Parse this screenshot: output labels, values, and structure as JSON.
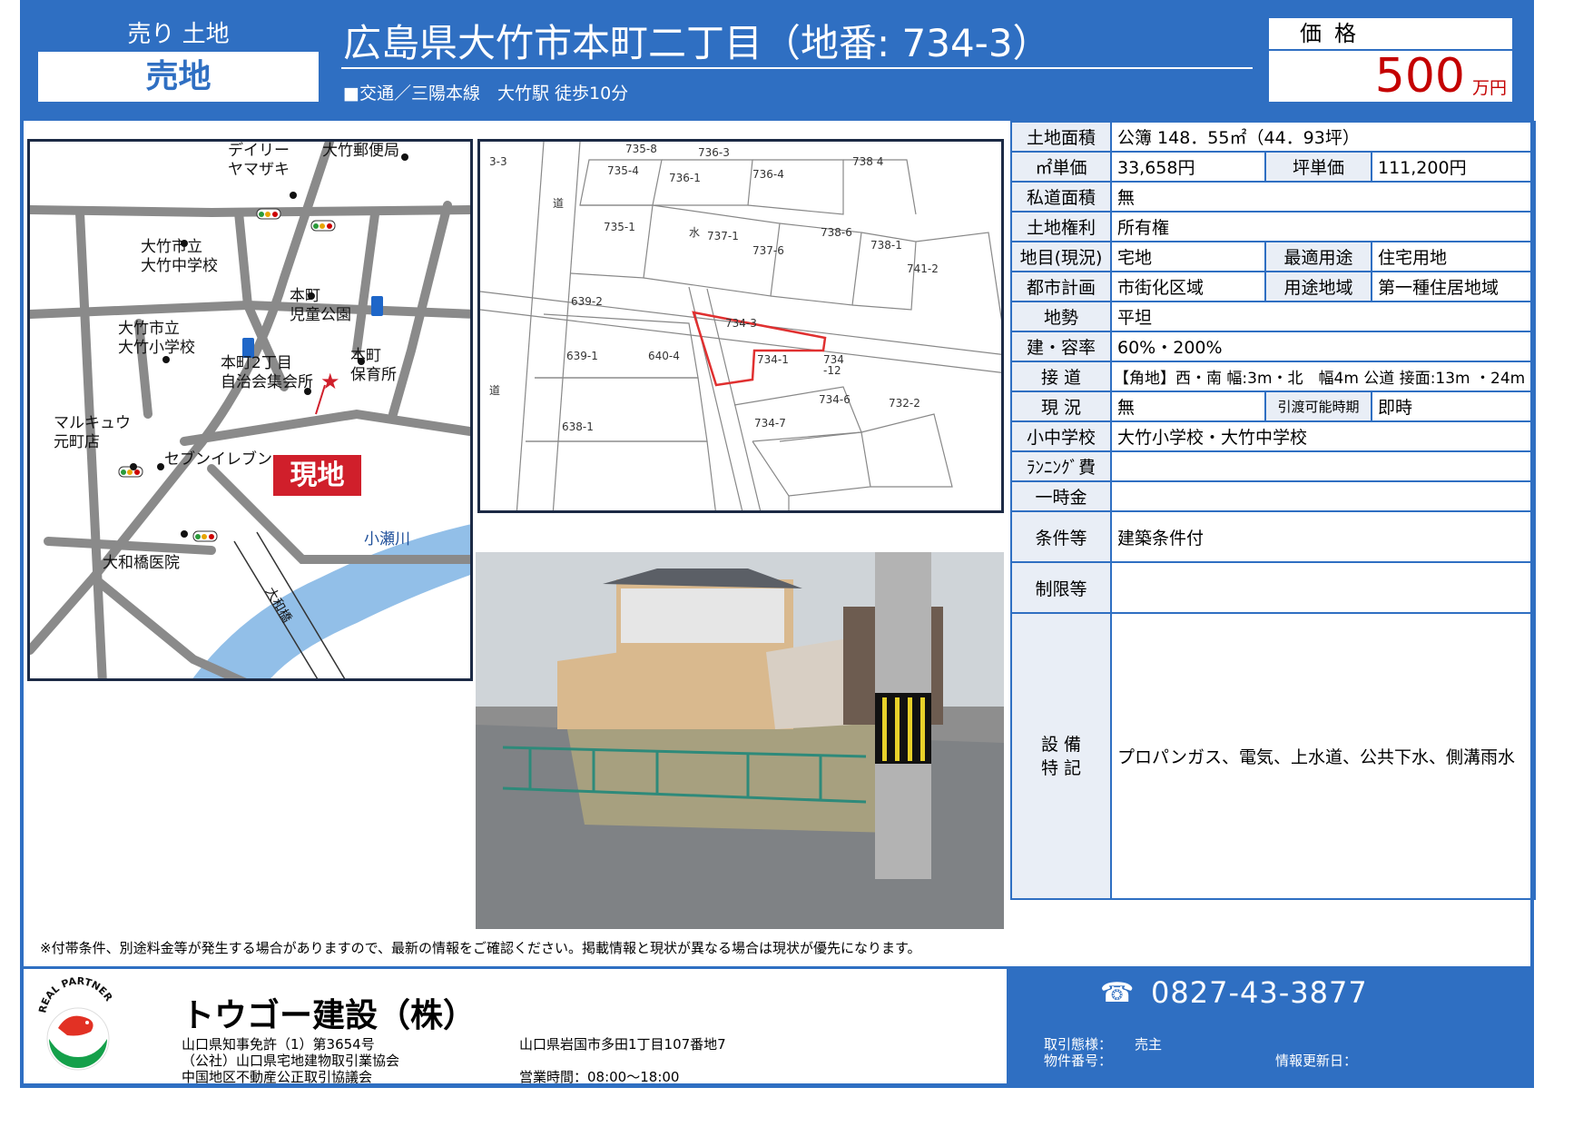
{
  "header": {
    "category_top": "売り 土地",
    "category_bottom": "売地",
    "title": "広島県大竹市本町二丁目（地番: 734-3）",
    "station": "■交通／三陽本線　大竹駅 徒歩10分",
    "price_label": "価格",
    "price_value": "500",
    "price_unit": "万円"
  },
  "map": {
    "labels": {
      "daily": "デイリー\nヤマザキ",
      "post": "大竹郵便局",
      "jhs": "大竹市立\n大竹中学校",
      "park": "本町\n児童公園",
      "es": "大竹市立\n大竹小学校",
      "hall": "本町2丁目\n自治会集会所",
      "nursery": "本町\n保育所",
      "genchi": "現地",
      "marukyu": "マルキュウ\n元町店",
      "seven": "セブンイレブン",
      "river": "小瀬川",
      "hospital": "大和橋医院",
      "bridge": "大和橋"
    }
  },
  "plot": {
    "lots": [
      "735-8",
      "736-3",
      "738 4",
      "3-3",
      "735-4",
      "736-1",
      "736-4",
      "道",
      "735-1",
      "水",
      "737-1",
      "737-6",
      "738-6",
      "738-1",
      "741-2",
      "639-2",
      "734-3",
      "639-1",
      "640-4",
      "734-1",
      "734\n-12",
      "道",
      "734-6",
      "732-2",
      "638-1",
      "734-7"
    ]
  },
  "notice": "※付帯条件、別途料金等が発生する場合がありますので、最新の情報をご確認ください。掲載情報と現状が異なる場合は現状が優先になります。",
  "specs": {
    "land_area_k": "土地面積",
    "land_area_v": "公簿 148．55㎡（44．93坪）",
    "sqm_price_k": "㎡単価",
    "sqm_price_v": "33,658円",
    "tsubo_price_k": "坪単価",
    "tsubo_price_v": "111,200円",
    "private_road_k": "私道面積",
    "private_road_v": "無",
    "rights_k": "土地権利",
    "rights_v": "所有権",
    "land_cat_k": "地目(現況)",
    "land_cat_v": "宅地",
    "best_use_k": "最適用途",
    "best_use_v": "住宅用地",
    "city_plan_k": "都市計画",
    "city_plan_v": "市街化区域",
    "zoning_k": "用途地域",
    "zoning_v": "第一種住居地域",
    "terrain_k": "地勢",
    "terrain_v": "平坦",
    "ratio_k": "建・容率",
    "ratio_v": "60%・200%",
    "road_k": "接 道",
    "road_v": "【角地】西・南 幅:3m・北　幅4m 公道 接面:13m ・24m",
    "status_k": "現 況",
    "status_v": "無",
    "handover_k": "引渡可能時期",
    "handover_v": "即時",
    "school_k": "小中学校",
    "school_v": "大竹小学校・大竹中学校",
    "running_k": "ﾗﾝﾆﾝｸﾞ費",
    "running_v": "",
    "lump_k": "一時金",
    "lump_v": "",
    "conditions_k": "条件等",
    "conditions_v": "建築条件付",
    "restrictions_k": "制限等",
    "restrictions_v": "",
    "facilities_k1": "設 備",
    "facilities_k2": "特 記",
    "facilities_v": "プロパンガス、電気、上水道、公共下水、側溝雨水"
  },
  "footer": {
    "logo_text": "REAL PARTNER",
    "company": "トウゴー建設（株）",
    "license1": "山口県知事免許（1）第3654号",
    "license2": "（公社）山口県宅地建物取引業協会",
    "license3": "中国地区不動産公正取引協議会",
    "address": "山口県岩国市多田1丁目107番地7",
    "hours": "営業時間：08:00～18:00",
    "phone": "0827-43-3877",
    "trade_k": "取引態様：",
    "trade_v": "売主",
    "property_no_k": "物件番号：",
    "updated_k": "情報更新日："
  },
  "colors": {
    "brand_blue": "#2f6fc2",
    "price_red": "#c40000",
    "genchi_red": "#d01f2b"
  }
}
